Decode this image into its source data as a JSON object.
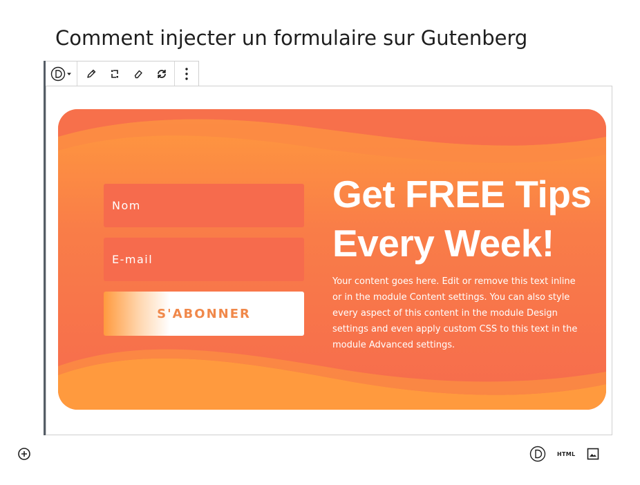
{
  "post": {
    "title": "Comment injecter un formulaire sur Gutenberg"
  },
  "toolbar": {
    "items": [
      {
        "icon": "divi-logo-icon"
      },
      {
        "icon": "pencil-icon"
      },
      {
        "icon": "transform-icon"
      },
      {
        "icon": "eraser-icon"
      },
      {
        "icon": "refresh-icon"
      },
      {
        "icon": "more-options-icon"
      }
    ]
  },
  "optin": {
    "fields": {
      "name_placeholder": "Nom",
      "email_placeholder": "E-mail"
    },
    "button_label": "S'ABONNER",
    "headline_line1": "Get FREE Tips",
    "headline_line2": "Every Week!",
    "body": "Your content goes here. Edit or remove this text inline or in the module Content settings. You can also style every aspect of this content in the module Design settings and even apply custom CSS to this text in the module Advanced settings.",
    "colors": {
      "top": "#ff9a3e",
      "bottom": "#f66b4d",
      "field": "#f66b4d",
      "button_text": "#f0884a"
    }
  },
  "bottom_tools": {
    "html_label": "HTML",
    "icons": [
      "divi-logo-icon",
      "html-icon",
      "image-icon"
    ]
  },
  "inserter": {
    "icon": "add-block-icon"
  }
}
